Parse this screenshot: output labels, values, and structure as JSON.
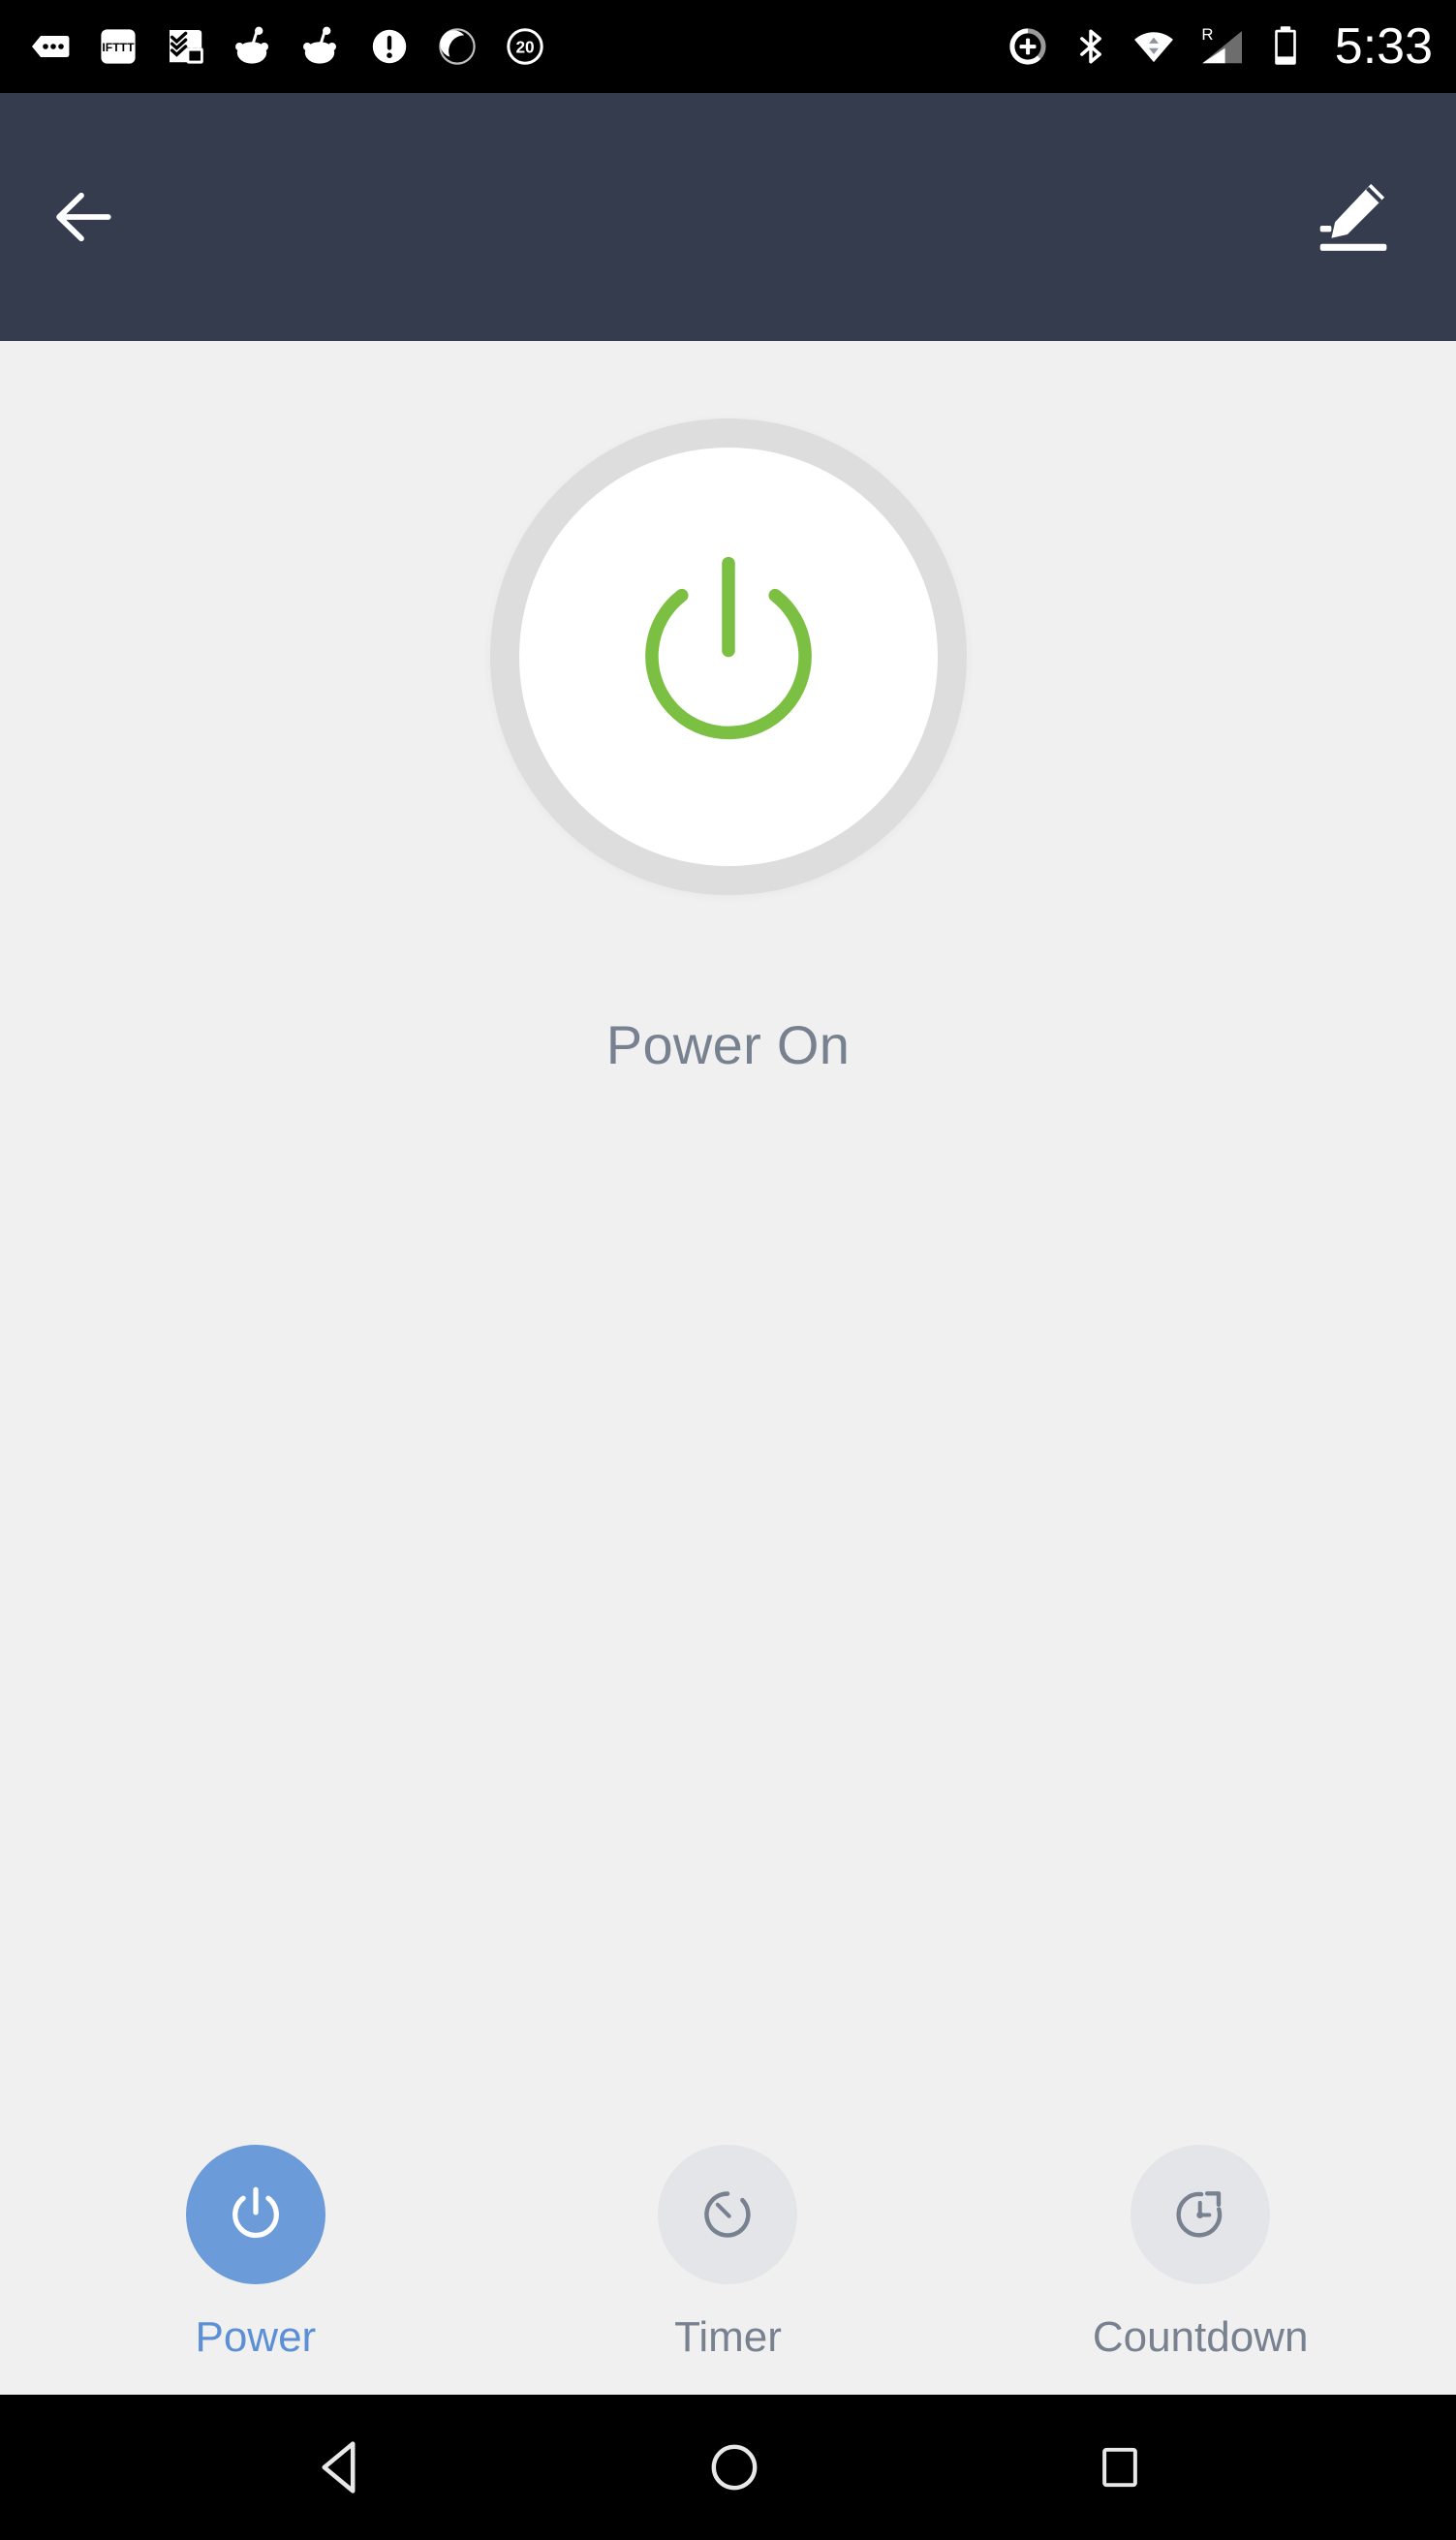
{
  "status_bar": {
    "notifications": [
      {
        "name": "tag-dots-icon",
        "label": "Tag notification"
      },
      {
        "name": "ifttt-icon",
        "label": "IFTTT"
      },
      {
        "name": "checklist-icon",
        "label": "Tasks"
      },
      {
        "name": "reddit-icon-1",
        "label": "Reddit"
      },
      {
        "name": "reddit-icon-2",
        "label": "Reddit"
      },
      {
        "name": "exclamation-circle-icon",
        "label": "Alert"
      },
      {
        "name": "moon-icon",
        "label": "Do Not Disturb"
      },
      {
        "name": "badge-20-icon",
        "label": "20"
      }
    ],
    "badge_count": "20",
    "system": [
      {
        "name": "data-saver-icon",
        "label": "Data saver"
      },
      {
        "name": "bluetooth-icon",
        "label": "Bluetooth"
      },
      {
        "name": "wifi-icon",
        "label": "Wi-Fi"
      },
      {
        "name": "cellular-signal-icon",
        "label": "Signal"
      },
      {
        "name": "battery-icon",
        "label": "Battery"
      }
    ],
    "roaming_label": "R",
    "clock": "5:33"
  },
  "app_bar": {
    "back_label": "Back",
    "edit_label": "Edit"
  },
  "main": {
    "power_button_label": "Power toggle",
    "power_state": "on",
    "status_text": "Power On",
    "accent_green": "#7bc043",
    "ring_color": "#dddddd",
    "background": "#f0f0f0"
  },
  "tabs": [
    {
      "id": "power",
      "label": "Power",
      "icon": "power-icon",
      "active": true
    },
    {
      "id": "timer",
      "label": "Timer",
      "icon": "timer-icon",
      "active": false
    },
    {
      "id": "countdown",
      "label": "Countdown",
      "icon": "countdown-icon",
      "active": false
    }
  ],
  "tab_colors": {
    "active_bg": "#6c9bd9",
    "active_text": "#5b8fd6",
    "inactive_bg": "#e4e5e8",
    "inactive_text": "#78818f"
  },
  "nav_bar": {
    "back_label": "Back",
    "home_label": "Home",
    "recents_label": "Recent apps"
  }
}
